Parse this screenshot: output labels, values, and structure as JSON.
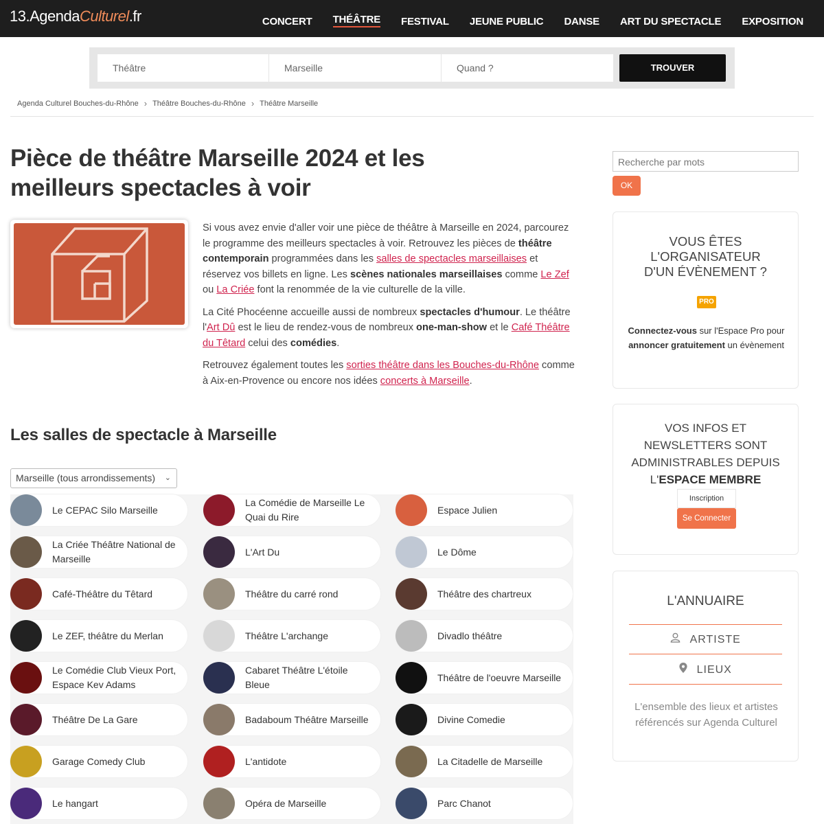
{
  "logo": {
    "prefix": "13.",
    "brand_a": "Agenda",
    "brand_b": "Culturel",
    "suffix": ".fr"
  },
  "nav": [
    {
      "label": "CONCERT"
    },
    {
      "label": "THÉÂTRE",
      "active": true
    },
    {
      "label": "FESTIVAL"
    },
    {
      "label": "JEUNE PUBLIC"
    },
    {
      "label": "DANSE"
    },
    {
      "label": "ART DU SPECTACLE"
    },
    {
      "label": "EXPOSITION"
    }
  ],
  "search": {
    "category": "Théâtre",
    "city": "Marseille",
    "when": "Quand ?",
    "button": "TROUVER"
  },
  "breadcrumb": [
    "Agenda Culturel Bouches-du-Rhône",
    "Théâtre Bouches-du-Rhône",
    "Théâtre Marseille"
  ],
  "page_title": "Pièce de théâtre Marseille 2024 et les meilleurs spectacles à voir",
  "intro": {
    "p1": [
      {
        "t": "Si vous avez envie d'aller voir une pièce de théâtre à Marseille en 2024, parcourez le programme des meilleurs spectacles à voir. Retrouvez les pièces de "
      },
      {
        "t": "théâtre contemporain",
        "b": true
      },
      {
        "t": " programmées dans les "
      },
      {
        "t": "salles de spectacles marseillaises",
        "a": true
      },
      {
        "t": " et réservez vos billets en ligne. Les "
      },
      {
        "t": "scènes nationales marseillaises",
        "b": true
      },
      {
        "t": " comme "
      },
      {
        "t": "Le Zef",
        "a": true
      },
      {
        "t": " ou "
      },
      {
        "t": "La Criée",
        "a": true
      },
      {
        "t": " font la renommée de la vie culturelle de la ville."
      }
    ],
    "p2": [
      {
        "t": "La Cité Phocéenne accueille aussi de nombreux "
      },
      {
        "t": "spectacles d'humour",
        "b": true
      },
      {
        "t": ". Le théâtre l'"
      },
      {
        "t": "Art Dû",
        "a": true
      },
      {
        "t": " est le lieu de rendez-vous de nombreux "
      },
      {
        "t": "one-man-show",
        "b": true
      },
      {
        "t": " et le "
      },
      {
        "t": "Café Théâtre du Têtard",
        "a": true
      },
      {
        "t": " celui des "
      },
      {
        "t": "comédies",
        "b": true
      },
      {
        "t": "."
      }
    ],
    "p3": [
      {
        "t": "Retrouvez également toutes les "
      },
      {
        "t": "sorties théâtre dans les Bouches-du-Rhône",
        "a": true
      },
      {
        "t": " comme à Aix-en-Provence ou encore nos idées "
      },
      {
        "t": "concerts à Marseille",
        "a": true
      },
      {
        "t": "."
      }
    ]
  },
  "venues_title": "Les salles de spectacle à Marseille",
  "district_select": "Marseille (tous arrondissements)",
  "venues": [
    [
      "Le CEPAC Silo Marseille",
      "La Comédie de Marseille Le Quai du Rire",
      "Espace Julien"
    ],
    [
      "La Criée Théâtre National de Marseille",
      "L'Art Du",
      "Le Dôme"
    ],
    [
      "Café-Théâtre du Têtard",
      "Théâtre du carré rond",
      "Théâtre des chartreux"
    ],
    [
      "Le ZEF, théâtre du Merlan",
      "Théâtre L'archange",
      "Divadlo théâtre"
    ],
    [
      "Le Comédie Club Vieux Port, Espace Kev Adams",
      "Cabaret Théâtre L'étoile Bleue",
      "Théâtre de l'oeuvre Marseille"
    ],
    [
      "Théâtre De La Gare",
      "Badaboum Théâtre Marseille",
      "Divine Comedie"
    ],
    [
      "Garage Comedy Club",
      "L'antidote",
      "La Citadelle de Marseille"
    ],
    [
      "Le hangart",
      "Opéra de Marseille",
      "Parc Chanot"
    ]
  ],
  "venue_colors": [
    [
      "#7a8a9a",
      "#8c1a2a",
      "#d8603f"
    ],
    [
      "#6a5a48",
      "#3a2a40",
      "#c0c8d4"
    ],
    [
      "#7a2a20",
      "#9a9080",
      "#5a3a30"
    ],
    [
      "#222222",
      "#d8d8d8",
      "#bcbcbc"
    ],
    [
      "#6a1010",
      "#2a3050",
      "#111111"
    ],
    [
      "#5a1a2a",
      "#8a7a6a",
      "#1a1a1a"
    ],
    [
      "#c8a020",
      "#b02020",
      "#7a6a50"
    ],
    [
      "#4a2a7a",
      "#8a8070",
      "#3a4a6a"
    ]
  ],
  "sidebar": {
    "keyword_placeholder": "Recherche par mots",
    "ok": "OK",
    "organizer_title": "VOUS ÊTES L'ORGANISATEUR D'UN ÉVÈNEMENT ?",
    "pro_badge": "PRO",
    "organizer_text_b1": "Connectez-vous",
    "organizer_text_1": " sur l'Espace Pro pour ",
    "organizer_text_b2": "annoncer gratuitement",
    "organizer_text_2": " un évènement",
    "member_title_1": "VOS INFOS ET NEWSLETTERS SONT ADMINISTRABLES DEPUIS L'",
    "member_title_b": "ESPACE MEMBRE",
    "register": "Inscription",
    "login": "Se Connecter",
    "directory_title": "L'ANNUAIRE",
    "artist": "ARTISTE",
    "places": "LIEUX",
    "directory_desc": "L'ensemble des lieux et artistes référencés sur Agenda Culturel"
  },
  "colors": {
    "accent": "#f0734a",
    "link": "#d0234e",
    "topbar": "#1e1e1e"
  }
}
